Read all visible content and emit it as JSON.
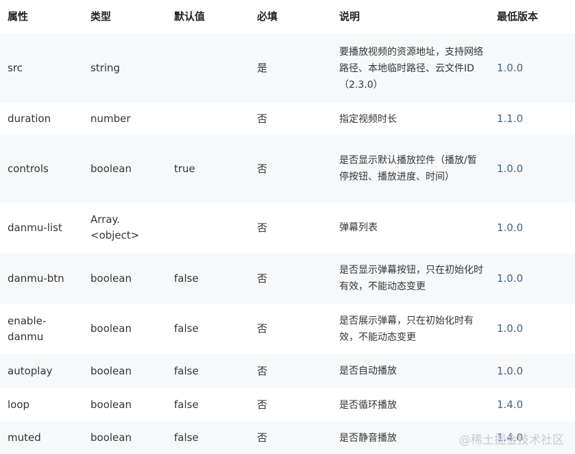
{
  "headers": [
    "属性",
    "类型",
    "默认值",
    "必填",
    "说明",
    "最低版本"
  ],
  "rows": [
    {
      "attr": "src",
      "type": "string",
      "default": "",
      "required": "是",
      "desc": "要播放视频的资源地址，支持网络路径、本地临时路径、云文件ID（2.3.0）",
      "version": "1.0.0"
    },
    {
      "attr": "duration",
      "type": "number",
      "default": "",
      "required": "否",
      "desc": "指定视频时长",
      "version": "1.1.0"
    },
    {
      "attr": "controls",
      "type": "boolean",
      "default": "true",
      "required": "否",
      "desc": "是否显示默认播放控件（播放/暂停按钮、播放进度、时间）",
      "version": "1.0.0"
    },
    {
      "attr": "danmu-list",
      "type": "Array.<object>",
      "default": "",
      "required": "否",
      "desc": "弹幕列表",
      "version": "1.0.0"
    },
    {
      "attr": "danmu-btn",
      "type": "boolean",
      "default": "false",
      "required": "否",
      "desc": "是否显示弹幕按钮，只在初始化时有效，不能动态变更",
      "version": "1.0.0"
    },
    {
      "attr": "enable-danmu",
      "type": "boolean",
      "default": "false",
      "required": "否",
      "desc": "是否展示弹幕，只在初始化时有效，不能动态变更",
      "version": "1.0.0"
    },
    {
      "attr": "autoplay",
      "type": "boolean",
      "default": "false",
      "required": "否",
      "desc": "是否自动播放",
      "version": "1.0.0"
    },
    {
      "attr": "loop",
      "type": "boolean",
      "default": "false",
      "required": "否",
      "desc": "是否循环播放",
      "version": "1.4.0"
    },
    {
      "attr": "muted",
      "type": "boolean",
      "default": "false",
      "required": "否",
      "desc": "是否静音播放",
      "version": "1.4.0"
    }
  ],
  "watermark": "@稀土掘金技术社区"
}
